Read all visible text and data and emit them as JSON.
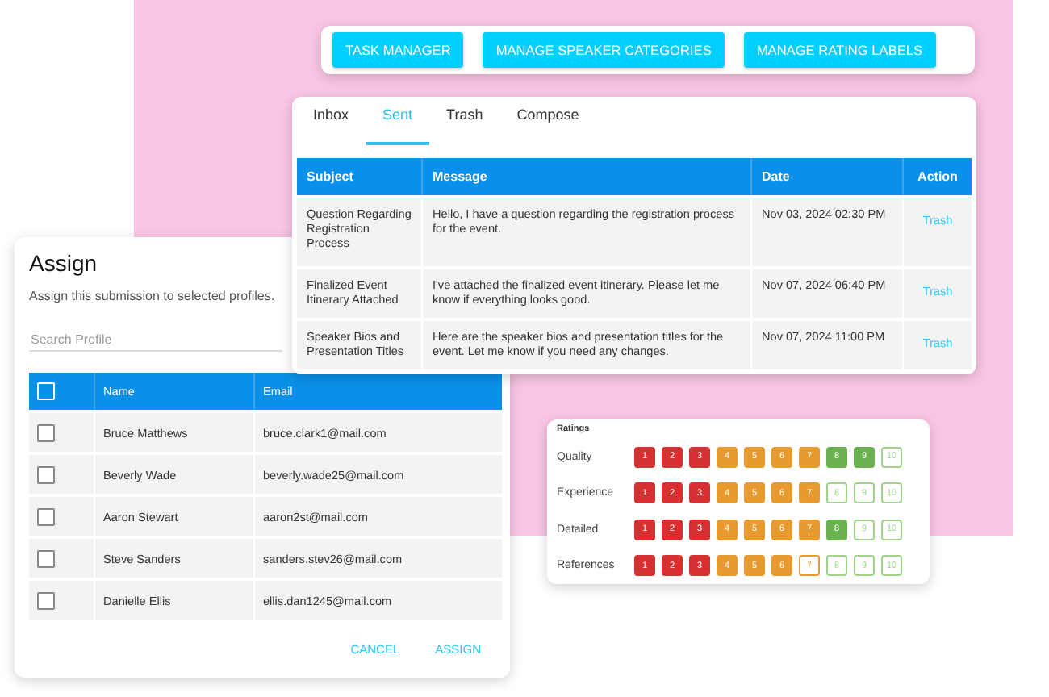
{
  "toolbar": {
    "buttons": [
      "TASK MANAGER",
      "MANAGE SPEAKER CATEGORIES",
      "MANAGE RATING LABELS"
    ]
  },
  "mail": {
    "tabs": [
      {
        "label": "Inbox",
        "selected": false
      },
      {
        "label": "Sent",
        "selected": true
      },
      {
        "label": "Trash",
        "selected": false
      },
      {
        "label": "Compose",
        "selected": false
      }
    ],
    "columns": [
      "Subject",
      "Message",
      "Date",
      "Action"
    ],
    "rows": [
      {
        "subject": "Question Regarding Registration Process",
        "message": "Hello, I have a question regarding the registration process for the event.",
        "date": "Nov 03, 2024 02:30 PM",
        "action": "Trash"
      },
      {
        "subject": "Finalized Event Itinerary Attached",
        "message": "I've attached the finalized event itinerary. Please let me know if everything looks good.",
        "date": "Nov 07, 2024 06:40 PM",
        "action": "Trash"
      },
      {
        "subject": "Speaker Bios and Presentation Titles",
        "message": "Here are the speaker bios and presentation titles for the event. Let me know if you need any changes.",
        "date": "Nov 07, 2024 11:00 PM",
        "action": "Trash"
      }
    ]
  },
  "assign": {
    "title": "Assign",
    "description": "Assign this submission to selected profiles.",
    "search": {
      "placeholder": "Search Profile"
    },
    "select_all": {
      "checked": false
    },
    "columns": [
      "Name",
      "Email"
    ],
    "rows": [
      {
        "name": "Bruce Matthews",
        "email": "bruce.clark1@mail.com",
        "checked": false
      },
      {
        "name": "Beverly Wade",
        "email": "beverly.wade25@mail.com",
        "checked": false
      },
      {
        "name": "Aaron Stewart",
        "email": "aaron2st@mail.com",
        "checked": false
      },
      {
        "name": "Steve Sanders",
        "email": "sanders.stev26@mail.com",
        "checked": false
      },
      {
        "name": "Danielle Ellis",
        "email": "ellis.dan1245@mail.com",
        "checked": false
      }
    ],
    "buttons": [
      "CANCEL",
      "ASSIGN"
    ]
  },
  "ratings": {
    "title": "Ratings",
    "rows": [
      {
        "label": "Quality",
        "chips": [
          {
            "label": "1",
            "filled": true
          },
          {
            "label": "2",
            "filled": true
          },
          {
            "label": "3",
            "filled": true
          },
          {
            "label": "4",
            "filled": true
          },
          {
            "label": "5",
            "filled": true
          },
          {
            "label": "6",
            "filled": true
          },
          {
            "label": "7",
            "filled": true
          },
          {
            "label": "8",
            "filled": true
          },
          {
            "label": "9",
            "filled": true
          },
          {
            "label": "10",
            "filled": false
          }
        ]
      },
      {
        "label": "Experience",
        "chips": [
          {
            "label": "1",
            "filled": true
          },
          {
            "label": "2",
            "filled": true
          },
          {
            "label": "3",
            "filled": true
          },
          {
            "label": "4",
            "filled": true
          },
          {
            "label": "5",
            "filled": true
          },
          {
            "label": "6",
            "filled": true
          },
          {
            "label": "7",
            "filled": true
          },
          {
            "label": "8",
            "filled": false
          },
          {
            "label": "9",
            "filled": false
          },
          {
            "label": "10",
            "filled": false
          }
        ]
      },
      {
        "label": "Detailed",
        "chips": [
          {
            "label": "1",
            "filled": true
          },
          {
            "label": "2",
            "filled": true
          },
          {
            "label": "3",
            "filled": true
          },
          {
            "label": "4",
            "filled": true
          },
          {
            "label": "5",
            "filled": true
          },
          {
            "label": "6",
            "filled": true
          },
          {
            "label": "7",
            "filled": true
          },
          {
            "label": "8",
            "filled": true
          },
          {
            "label": "9",
            "filled": false
          },
          {
            "label": "10",
            "filled": false
          }
        ]
      },
      {
        "label": "References",
        "chips": [
          {
            "label": "1",
            "filled": true
          },
          {
            "label": "2",
            "filled": true
          },
          {
            "label": "3",
            "filled": true
          },
          {
            "label": "4",
            "filled": true
          },
          {
            "label": "5",
            "filled": true
          },
          {
            "label": "6",
            "filled": true
          },
          {
            "label": "7",
            "filled": false
          },
          {
            "label": "8",
            "filled": false
          },
          {
            "label": "9",
            "filled": false
          },
          {
            "label": "10",
            "filled": false
          }
        ]
      }
    ]
  }
}
